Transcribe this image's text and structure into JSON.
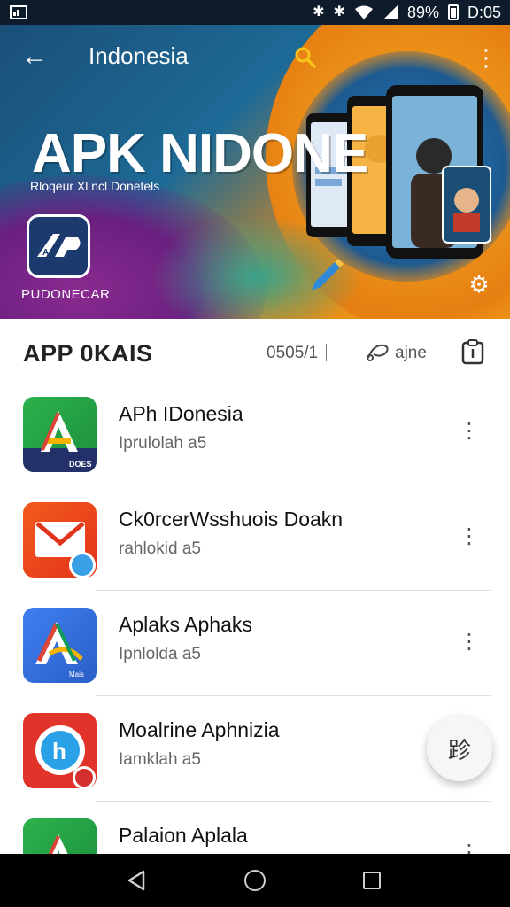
{
  "status_bar": {
    "time": "D:05",
    "battery": "89%",
    "icons": [
      "screenshot-icon",
      "bluetooth-icon",
      "vibrate-icon",
      "wifi-icon",
      "signal-icon",
      "battery-icon"
    ]
  },
  "toolbar": {
    "title": "Indonesia",
    "icons": [
      "back-arrow-icon",
      "search-icon",
      "more-vert-icon"
    ]
  },
  "banner": {
    "title": "APK NIDONE",
    "subtitle": "Rloqeur Xl ncl Donetels",
    "logo_label": "PUDONECAR",
    "logo_text": "AP",
    "icons": [
      "settings-gear-icon",
      "pen-icon"
    ]
  },
  "list_header": {
    "title": "APP 0KAIS",
    "count": "0505/1",
    "sort_label": "ajne",
    "icons": [
      "sort-icon",
      "clipboard-icon"
    ]
  },
  "items": [
    {
      "title": "APh IDonesia",
      "subtitle": "Iprulolah a5",
      "icon": "app-icon-green-a",
      "badge": "DOES"
    },
    {
      "title": "Ck0rcerWsshuois Doakn",
      "subtitle": "rahlokid a5",
      "icon": "app-icon-mail"
    },
    {
      "title": "Aplaks Aphaks",
      "subtitle": "Ipnlolda a5",
      "icon": "app-icon-blue-a",
      "badge": "Mais"
    },
    {
      "title": "Moalrine Aphnizia",
      "subtitle": "Iamklah a5",
      "icon": "app-icon-red-h"
    },
    {
      "title": "Palaion Aplala",
      "subtitle": "",
      "icon": "app-icon-green-a2"
    }
  ],
  "fab": {
    "label": "跈",
    "icon": "fab-icon"
  },
  "nav": {
    "icons": [
      "nav-back-icon",
      "nav-home-icon",
      "nav-recents-icon"
    ]
  },
  "colors": {
    "status_bar": "#0d1b2a",
    "banner_blue": "#1d6a96",
    "banner_orange": "#f3a21a",
    "banner_purple": "#8a2a8f",
    "list_bg": "#ffffff",
    "nav_bar": "#000000"
  }
}
